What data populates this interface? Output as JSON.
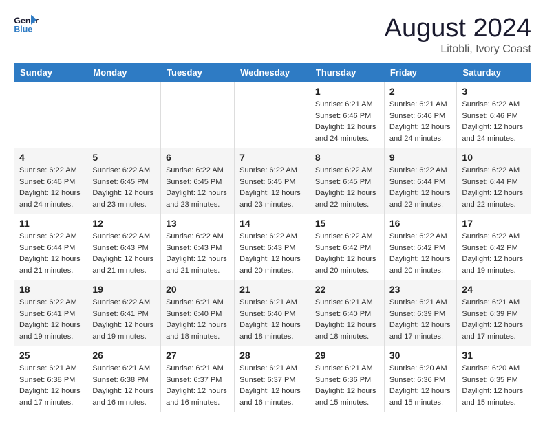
{
  "logo": {
    "line1": "General",
    "line2": "Blue"
  },
  "title": "August 2024",
  "location": "Litobli, Ivory Coast",
  "days_header": [
    "Sunday",
    "Monday",
    "Tuesday",
    "Wednesday",
    "Thursday",
    "Friday",
    "Saturday"
  ],
  "weeks": [
    [
      {
        "num": "",
        "sunrise": "",
        "sunset": "",
        "daylight": ""
      },
      {
        "num": "",
        "sunrise": "",
        "sunset": "",
        "daylight": ""
      },
      {
        "num": "",
        "sunrise": "",
        "sunset": "",
        "daylight": ""
      },
      {
        "num": "",
        "sunrise": "",
        "sunset": "",
        "daylight": ""
      },
      {
        "num": "1",
        "sunrise": "Sunrise: 6:21 AM",
        "sunset": "Sunset: 6:46 PM",
        "daylight": "Daylight: 12 hours and 24 minutes."
      },
      {
        "num": "2",
        "sunrise": "Sunrise: 6:21 AM",
        "sunset": "Sunset: 6:46 PM",
        "daylight": "Daylight: 12 hours and 24 minutes."
      },
      {
        "num": "3",
        "sunrise": "Sunrise: 6:22 AM",
        "sunset": "Sunset: 6:46 PM",
        "daylight": "Daylight: 12 hours and 24 minutes."
      }
    ],
    [
      {
        "num": "4",
        "sunrise": "Sunrise: 6:22 AM",
        "sunset": "Sunset: 6:46 PM",
        "daylight": "Daylight: 12 hours and 24 minutes."
      },
      {
        "num": "5",
        "sunrise": "Sunrise: 6:22 AM",
        "sunset": "Sunset: 6:45 PM",
        "daylight": "Daylight: 12 hours and 23 minutes."
      },
      {
        "num": "6",
        "sunrise": "Sunrise: 6:22 AM",
        "sunset": "Sunset: 6:45 PM",
        "daylight": "Daylight: 12 hours and 23 minutes."
      },
      {
        "num": "7",
        "sunrise": "Sunrise: 6:22 AM",
        "sunset": "Sunset: 6:45 PM",
        "daylight": "Daylight: 12 hours and 23 minutes."
      },
      {
        "num": "8",
        "sunrise": "Sunrise: 6:22 AM",
        "sunset": "Sunset: 6:45 PM",
        "daylight": "Daylight: 12 hours and 22 minutes."
      },
      {
        "num": "9",
        "sunrise": "Sunrise: 6:22 AM",
        "sunset": "Sunset: 6:44 PM",
        "daylight": "Daylight: 12 hours and 22 minutes."
      },
      {
        "num": "10",
        "sunrise": "Sunrise: 6:22 AM",
        "sunset": "Sunset: 6:44 PM",
        "daylight": "Daylight: 12 hours and 22 minutes."
      }
    ],
    [
      {
        "num": "11",
        "sunrise": "Sunrise: 6:22 AM",
        "sunset": "Sunset: 6:44 PM",
        "daylight": "Daylight: 12 hours and 21 minutes."
      },
      {
        "num": "12",
        "sunrise": "Sunrise: 6:22 AM",
        "sunset": "Sunset: 6:43 PM",
        "daylight": "Daylight: 12 hours and 21 minutes."
      },
      {
        "num": "13",
        "sunrise": "Sunrise: 6:22 AM",
        "sunset": "Sunset: 6:43 PM",
        "daylight": "Daylight: 12 hours and 21 minutes."
      },
      {
        "num": "14",
        "sunrise": "Sunrise: 6:22 AM",
        "sunset": "Sunset: 6:43 PM",
        "daylight": "Daylight: 12 hours and 20 minutes."
      },
      {
        "num": "15",
        "sunrise": "Sunrise: 6:22 AM",
        "sunset": "Sunset: 6:42 PM",
        "daylight": "Daylight: 12 hours and 20 minutes."
      },
      {
        "num": "16",
        "sunrise": "Sunrise: 6:22 AM",
        "sunset": "Sunset: 6:42 PM",
        "daylight": "Daylight: 12 hours and 20 minutes."
      },
      {
        "num": "17",
        "sunrise": "Sunrise: 6:22 AM",
        "sunset": "Sunset: 6:42 PM",
        "daylight": "Daylight: 12 hours and 19 minutes."
      }
    ],
    [
      {
        "num": "18",
        "sunrise": "Sunrise: 6:22 AM",
        "sunset": "Sunset: 6:41 PM",
        "daylight": "Daylight: 12 hours and 19 minutes."
      },
      {
        "num": "19",
        "sunrise": "Sunrise: 6:22 AM",
        "sunset": "Sunset: 6:41 PM",
        "daylight": "Daylight: 12 hours and 19 minutes."
      },
      {
        "num": "20",
        "sunrise": "Sunrise: 6:21 AM",
        "sunset": "Sunset: 6:40 PM",
        "daylight": "Daylight: 12 hours and 18 minutes."
      },
      {
        "num": "21",
        "sunrise": "Sunrise: 6:21 AM",
        "sunset": "Sunset: 6:40 PM",
        "daylight": "Daylight: 12 hours and 18 minutes."
      },
      {
        "num": "22",
        "sunrise": "Sunrise: 6:21 AM",
        "sunset": "Sunset: 6:40 PM",
        "daylight": "Daylight: 12 hours and 18 minutes."
      },
      {
        "num": "23",
        "sunrise": "Sunrise: 6:21 AM",
        "sunset": "Sunset: 6:39 PM",
        "daylight": "Daylight: 12 hours and 17 minutes."
      },
      {
        "num": "24",
        "sunrise": "Sunrise: 6:21 AM",
        "sunset": "Sunset: 6:39 PM",
        "daylight": "Daylight: 12 hours and 17 minutes."
      }
    ],
    [
      {
        "num": "25",
        "sunrise": "Sunrise: 6:21 AM",
        "sunset": "Sunset: 6:38 PM",
        "daylight": "Daylight: 12 hours and 17 minutes."
      },
      {
        "num": "26",
        "sunrise": "Sunrise: 6:21 AM",
        "sunset": "Sunset: 6:38 PM",
        "daylight": "Daylight: 12 hours and 16 minutes."
      },
      {
        "num": "27",
        "sunrise": "Sunrise: 6:21 AM",
        "sunset": "Sunset: 6:37 PM",
        "daylight": "Daylight: 12 hours and 16 minutes."
      },
      {
        "num": "28",
        "sunrise": "Sunrise: 6:21 AM",
        "sunset": "Sunset: 6:37 PM",
        "daylight": "Daylight: 12 hours and 16 minutes."
      },
      {
        "num": "29",
        "sunrise": "Sunrise: 6:21 AM",
        "sunset": "Sunset: 6:36 PM",
        "daylight": "Daylight: 12 hours and 15 minutes."
      },
      {
        "num": "30",
        "sunrise": "Sunrise: 6:20 AM",
        "sunset": "Sunset: 6:36 PM",
        "daylight": "Daylight: 12 hours and 15 minutes."
      },
      {
        "num": "31",
        "sunrise": "Sunrise: 6:20 AM",
        "sunset": "Sunset: 6:35 PM",
        "daylight": "Daylight: 12 hours and 15 minutes."
      }
    ]
  ]
}
